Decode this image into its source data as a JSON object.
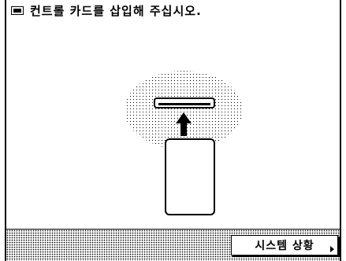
{
  "header": {
    "message": "컨트롤 카드를 삽입해 주십시오.",
    "icon": "card-slot-icon"
  },
  "illustration": {
    "icon": "insert-card-illustration"
  },
  "footer": {
    "system_status_label": "시스템 상황"
  }
}
